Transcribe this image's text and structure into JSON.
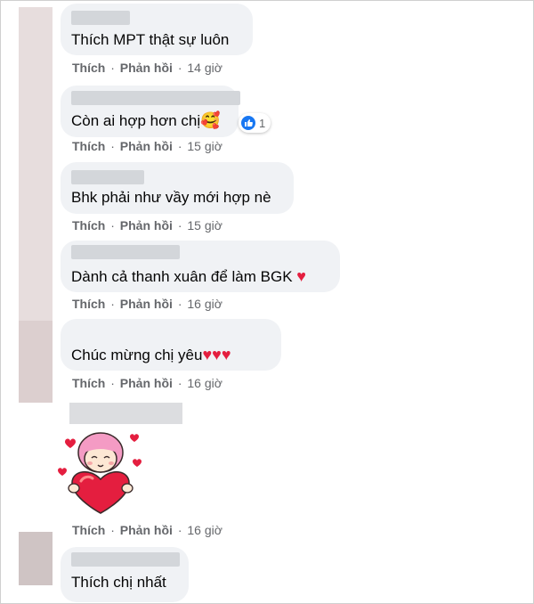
{
  "actions": {
    "like": "Thích",
    "reply": "Phản hồi",
    "sep": "·"
  },
  "comments": [
    {
      "text": "Thích MPT thật sự luôn",
      "emoji": "",
      "time": "14 giờ"
    },
    {
      "text": "Còn ai hợp hơn chị",
      "emoji": "🥰",
      "time": "15 giờ",
      "reaction_count": "1"
    },
    {
      "text": "Bhk phải như vầy mới hợp nè",
      "emoji": "",
      "time": "15 giờ"
    },
    {
      "text": "Dành cả thanh xuân để làm BGK ",
      "emoji": "♥",
      "time": "16 giờ"
    },
    {
      "text": "Chúc mừng chị yêu",
      "emoji": "♥♥♥",
      "time": "16 giờ"
    },
    {
      "text": "",
      "emoji": "",
      "time": "16 giờ",
      "sticker": "girl-heart-sticker"
    },
    {
      "text": "Thích chị nhất",
      "emoji": "",
      "time": ""
    }
  ],
  "colors": {
    "bubble": "#f0f2f5",
    "heart": "#e41e3f",
    "like_blue": "#1877f2",
    "meta": "#65676b"
  }
}
